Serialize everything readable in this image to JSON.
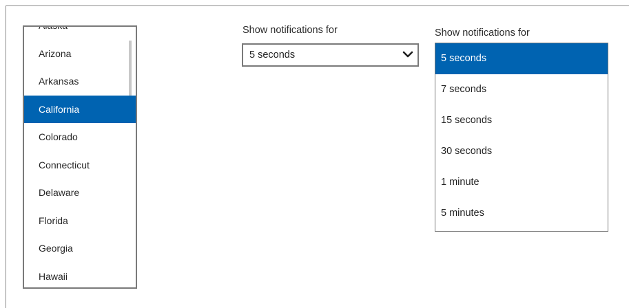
{
  "states_list": {
    "items": [
      "Alaska",
      "Arizona",
      "Arkansas",
      "California",
      "Colorado",
      "Connecticut",
      "Delaware",
      "Florida",
      "Georgia",
      "Hawaii"
    ],
    "selected": "California"
  },
  "combo_collapsed": {
    "label": "Show notifications for",
    "value": "5 seconds",
    "icon": "chevron-down-icon"
  },
  "combo_expanded": {
    "label": "Show notifications for",
    "options": [
      "5 seconds",
      "7 seconds",
      "15 seconds",
      "30 seconds",
      "1 minute",
      "5 minutes"
    ],
    "selected": "5 seconds"
  },
  "colors": {
    "selection": "#0063b1",
    "border": "#7a7a7a"
  }
}
